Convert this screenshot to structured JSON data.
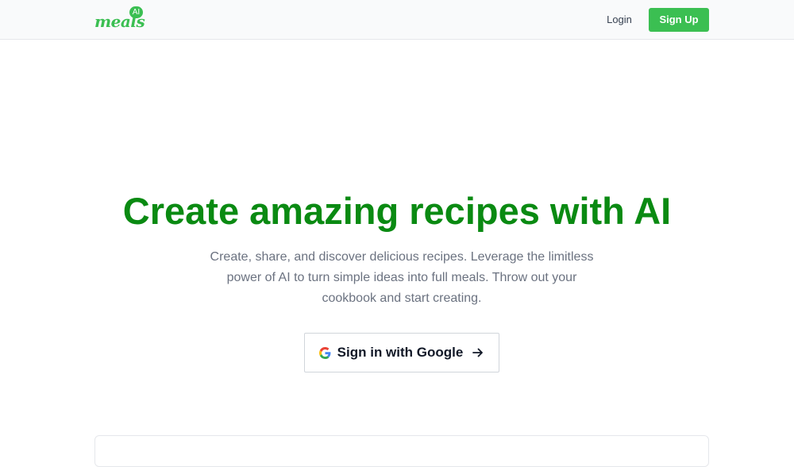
{
  "brand": {
    "name": "meals",
    "badge": "AI",
    "color": "#3bbf52"
  },
  "nav": {
    "login_label": "Login",
    "signup_label": "Sign Up"
  },
  "hero": {
    "title": "Create amazing recipes with AI",
    "subtitle": "Create, share, and discover delicious recipes. Leverage the limitless power of AI to turn simple ideas into full meals. Throw out your cookbook and start creating.",
    "title_color": "#0a8a12"
  },
  "cta": {
    "google_label": "Sign in with Google",
    "icon_left": "google-icon",
    "icon_right": "arrow-right-icon"
  }
}
